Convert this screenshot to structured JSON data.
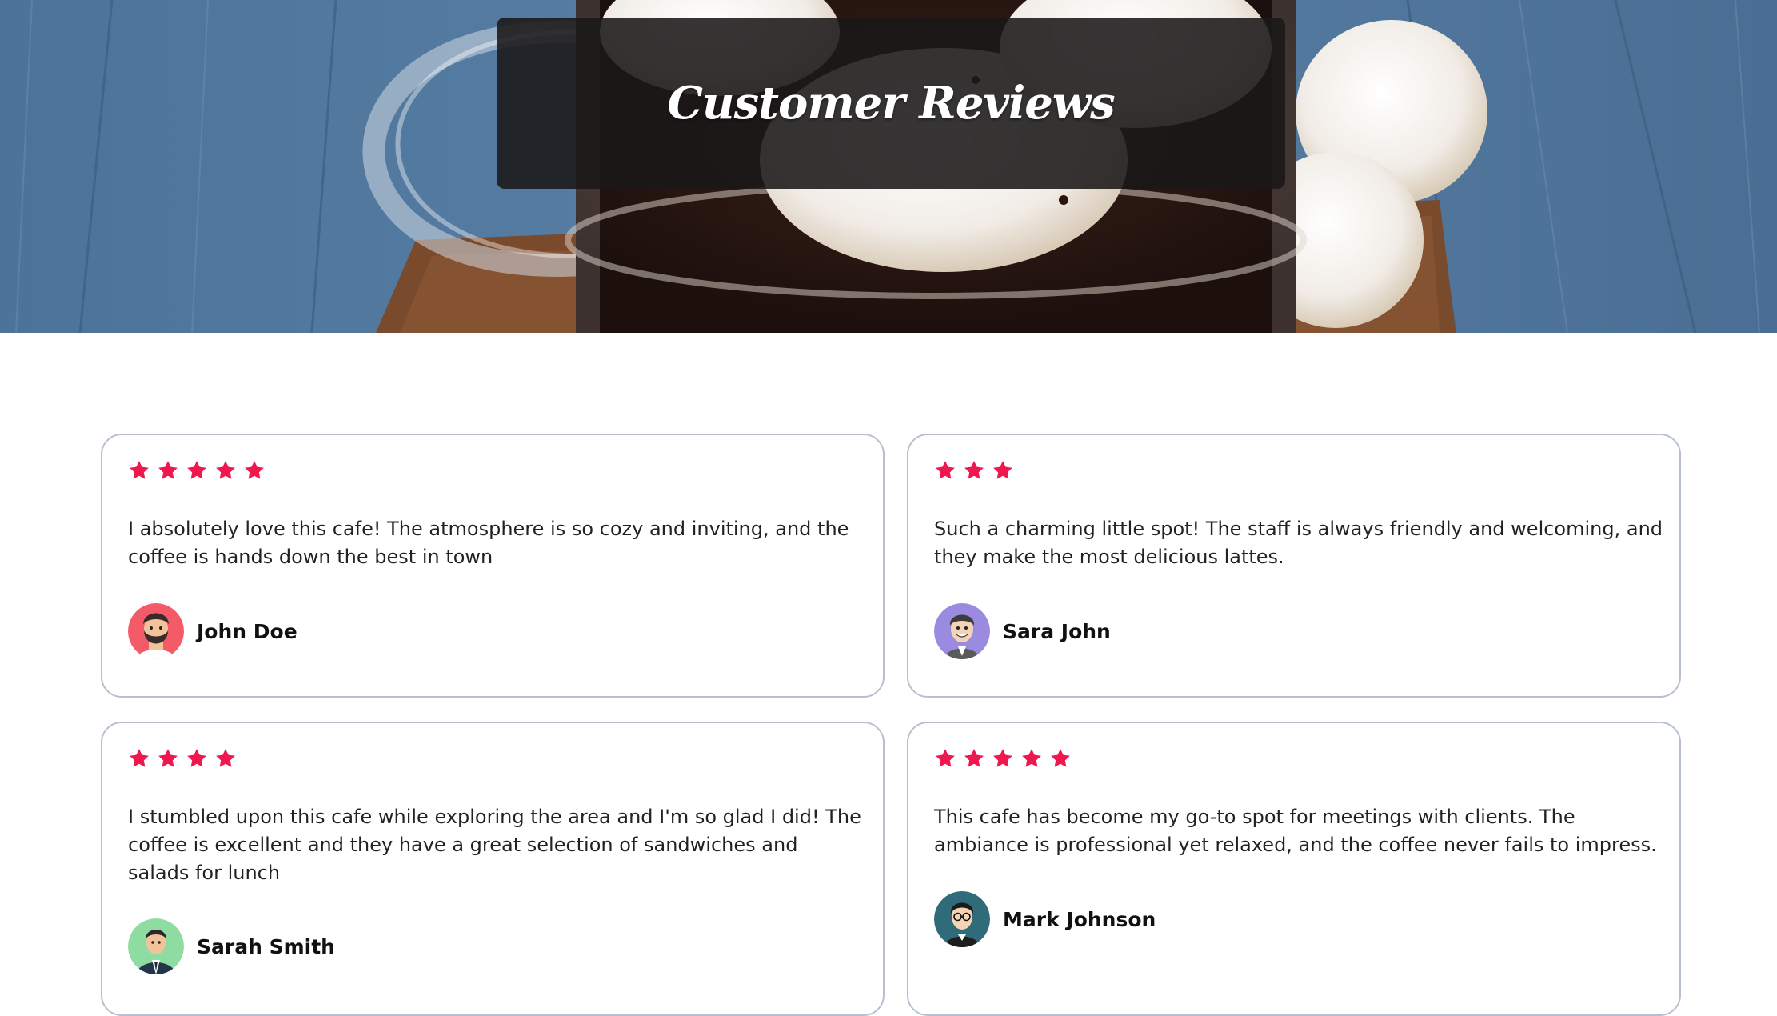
{
  "header": {
    "title": "Customer Reviews"
  },
  "colors": {
    "star": "#f0174e",
    "card_border": "#b7bfd0",
    "title_box": "#1a1818"
  },
  "reviews": [
    {
      "rating": 5,
      "text": "I absolutely love this cafe! The atmosphere is so cozy and inviting, and the coffee is hands down the best in town",
      "author": "John Doe",
      "avatar_icon": "bearded-man-avatar-icon"
    },
    {
      "rating": 3,
      "text": "Such a charming little spot! The staff is always friendly and welcoming, and they make the most delicious lattes.",
      "author": "Sara John",
      "avatar_icon": "smiling-man-avatar-icon"
    },
    {
      "rating": 4,
      "text": "I stumbled upon this cafe while exploring the area and I'm so glad I did! The coffee is excellent and they have a great selection of sandwiches and salads for lunch",
      "author": "Sarah Smith",
      "avatar_icon": "man-in-suit-avatar-icon"
    },
    {
      "rating": 5,
      "text": "This cafe has become my go-to spot for meetings with clients. The ambiance is professional yet relaxed, and the coffee never fails to impress.",
      "author": "Mark Johnson",
      "avatar_icon": "man-with-glasses-avatar-icon"
    }
  ]
}
